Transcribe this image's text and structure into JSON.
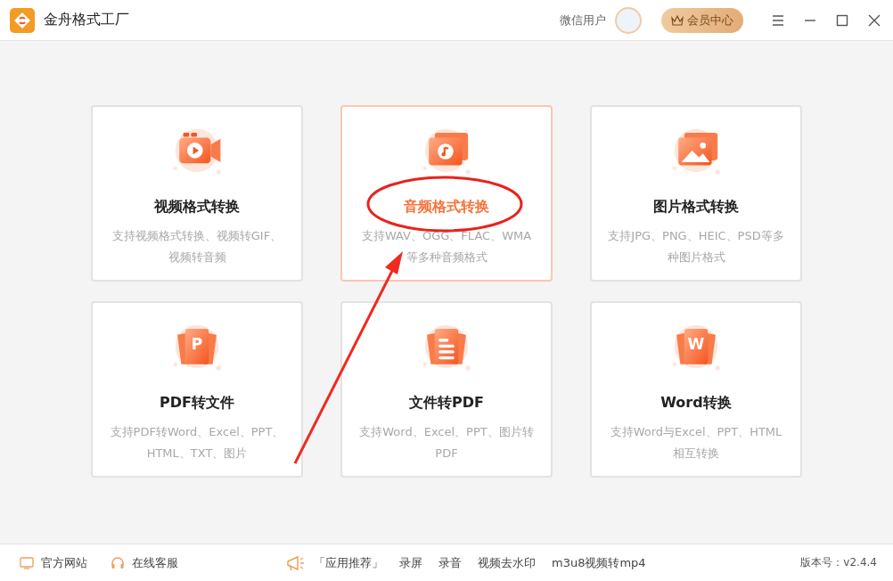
{
  "window": {
    "title": "金舟格式工厂"
  },
  "user": {
    "name": "微信用户"
  },
  "vip_button": "会员中心",
  "cards": [
    {
      "kind": "video",
      "title": "视频格式转换",
      "description": "支持视频格式转换、视频转GIF、视频转音频",
      "selected": false
    },
    {
      "kind": "audio",
      "title": "音频格式转换",
      "description": "支持WAV、OGG、FLAC、WMA等多种音频格式",
      "selected": true
    },
    {
      "kind": "image",
      "title": "图片格式转换",
      "description": "支持JPG、PNG、HEIC、PSD等多种图片格式",
      "selected": false
    },
    {
      "kind": "pdf",
      "icon_letter": "P",
      "title": "PDF转文件",
      "description": "支持PDF转Word、Excel、PPT、HTML、TXT、图片",
      "selected": false
    },
    {
      "kind": "doc",
      "title": "文件转PDF",
      "description": "支持Word、Excel、PPT、图片转PDF",
      "selected": false
    },
    {
      "kind": "word",
      "icon_letter": "W",
      "title": "Word转换",
      "description": "支持Word与Excel、PPT、HTML相互转换",
      "selected": false
    }
  ],
  "footer": {
    "links": [
      {
        "kind": "website",
        "label": "官方网站"
      },
      {
        "kind": "support",
        "label": "在线客服"
      }
    ],
    "recommend_label": "「应用推荐」",
    "apps": [
      "录屏",
      "录音",
      "视频去水印",
      "m3u8视频转mp4"
    ],
    "version": "版本号：v2.4.4"
  }
}
